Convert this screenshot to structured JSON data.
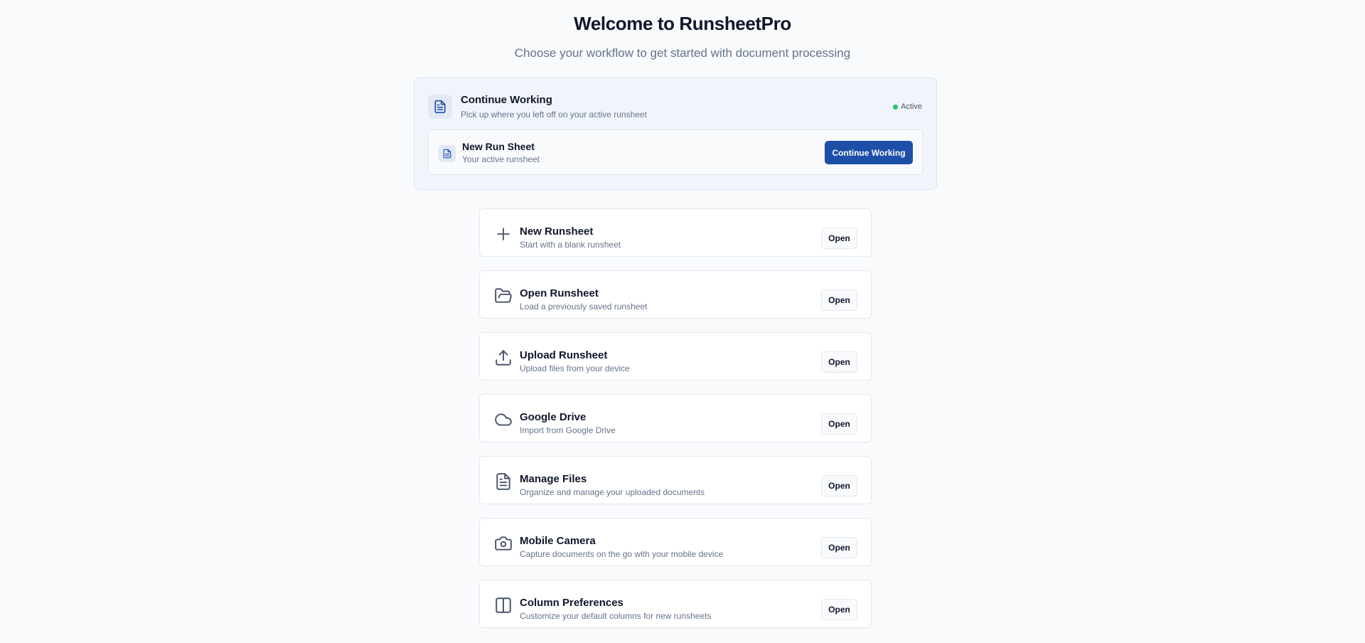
{
  "header": {
    "title": "Welcome to RunsheetPro",
    "subtitle": "Choose your workflow to get started with document processing"
  },
  "continue_panel": {
    "title": "Continue Working",
    "subtitle": "Pick up where you left off on your active runsheet",
    "status": "Active",
    "status_color": "#22c55e",
    "runsheet": {
      "name": "New Run Sheet",
      "description": "Your active runsheet"
    },
    "button_label": "Continue Working",
    "accent_color": "#1d4fa8"
  },
  "options": [
    {
      "icon": "plus-icon",
      "title": "New Runsheet",
      "subtitle": "Start with a blank runsheet",
      "button": "Open"
    },
    {
      "icon": "folder-open-icon",
      "title": "Open Runsheet",
      "subtitle": "Load a previously saved runsheet",
      "button": "Open"
    },
    {
      "icon": "upload-icon",
      "title": "Upload Runsheet",
      "subtitle": "Upload files from your device",
      "button": "Open"
    },
    {
      "icon": "cloud-icon",
      "title": "Google Drive",
      "subtitle": "Import from Google Drive",
      "button": "Open"
    },
    {
      "icon": "file-text-icon",
      "title": "Manage Files",
      "subtitle": "Organize and manage your uploaded documents",
      "button": "Open"
    },
    {
      "icon": "camera-icon",
      "title": "Mobile Camera",
      "subtitle": "Capture documents on the go with your mobile device",
      "button": "Open"
    },
    {
      "icon": "columns-icon",
      "title": "Column Preferences",
      "subtitle": "Customize your default columns for new runsheets",
      "button": "Open"
    }
  ]
}
